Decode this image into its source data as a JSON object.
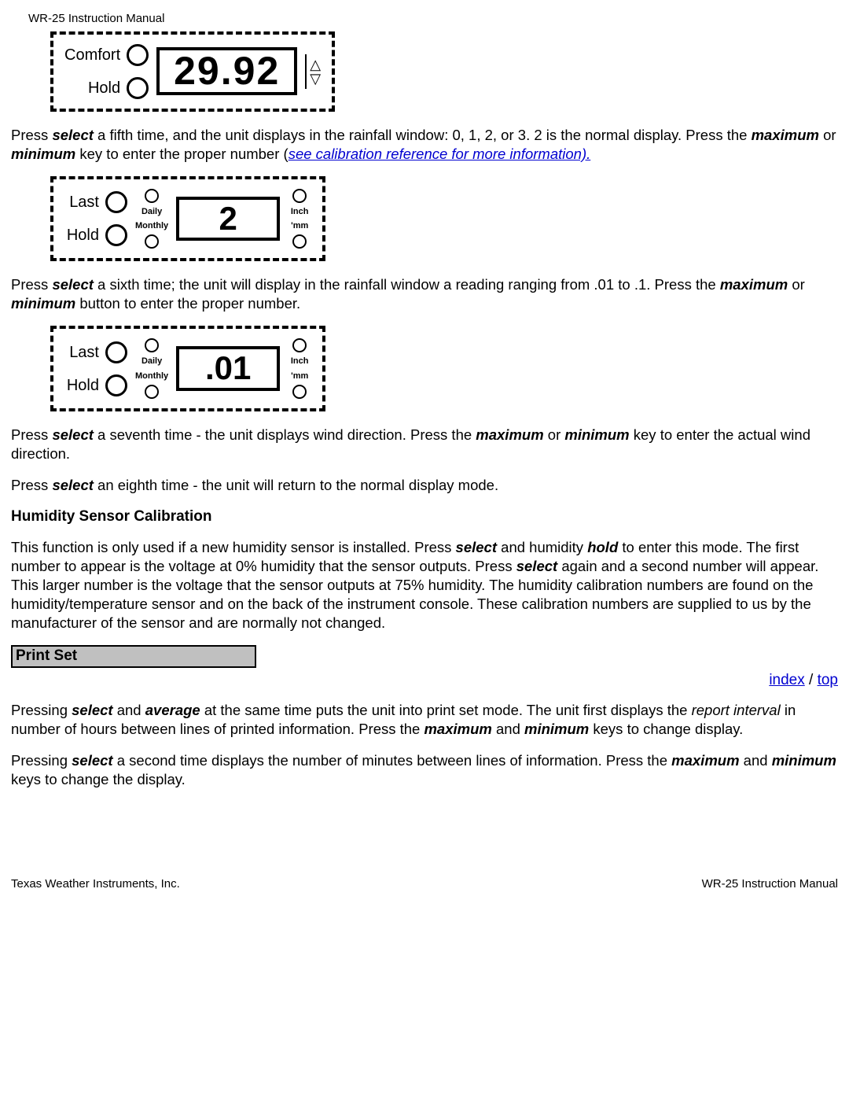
{
  "header": {
    "title": "WR-25 Instruction Manual"
  },
  "panel1": {
    "label1": "Comfort",
    "label2": "Hold",
    "value": "29.92",
    "up": "△",
    "down": "▽"
  },
  "para1a": "Press ",
  "kw_select": "select",
  "para1b": " a fifth time, and the unit displays in the rainfall window: 0, 1, 2, or 3. 2 is the normal display. Press the ",
  "kw_maximum": "maximum",
  "para1c": " or ",
  "kw_minimum": "minimum",
  "para1d": " key to enter the proper number (",
  "link_calib": "see calibration reference for more information).",
  "panel2": {
    "label1": "Last",
    "label2": "Hold",
    "mid1": "Daily",
    "mid2": "Monthly",
    "value": "2",
    "r1": "Inch",
    "r2": "'mm"
  },
  "para2a": " a sixth time; the unit will display in the rainfall window a reading ranging from .01 to .1. Press the ",
  "para2b": " button to enter the proper number.",
  "panel3": {
    "label1": "Last",
    "label2": "Hold",
    "mid1": "Daily",
    "mid2": "Monthly",
    "value": ".01",
    "r1": "Inch",
    "r2": "'mm"
  },
  "para3a": " a seventh time - the unit displays wind direction. Press the ",
  "para3b": " key to enter the actual wind direction.",
  "para4": " an eighth time - the unit will return to the normal display mode.",
  "h_humidity": "Humidity Sensor Calibration",
  "para5a": "This function is only used if a new humidity sensor is installed. Press ",
  "para5b": " and humidity ",
  "kw_hold": "hold",
  "para5c": " to enter this mode. The first number to appear is the voltage at 0% humidity that the sensor outputs. Press ",
  "para5d": " again and a second number will appear. This larger number is the voltage that the sensor outputs at 75% humidity. The humidity calibration numbers are found on the humidity/temperature sensor and on the back of the instrument console. These calibration numbers are supplied to us by the manufacturer of the sensor and are normally not changed.",
  "banner_printset": "Print Set",
  "nav_index": "index",
  "nav_sep": " / ",
  "nav_top": "top",
  "para6a": "Pressing ",
  "para6b": " and ",
  "kw_average": "average",
  "para6c": " at the same time puts the unit into print set mode. The unit first displays the ",
  "em_report": "report interval",
  "para6d": " in number of hours between lines of printed information. Press the ",
  "para6e": " keys to change display.",
  "para7a": " a second time displays the number of minutes between lines of information. Press the ",
  "para7b": " keys to change the display.",
  "footer": {
    "left": "Texas Weather Instruments, Inc.",
    "right": "WR-25 Instruction Manual"
  }
}
